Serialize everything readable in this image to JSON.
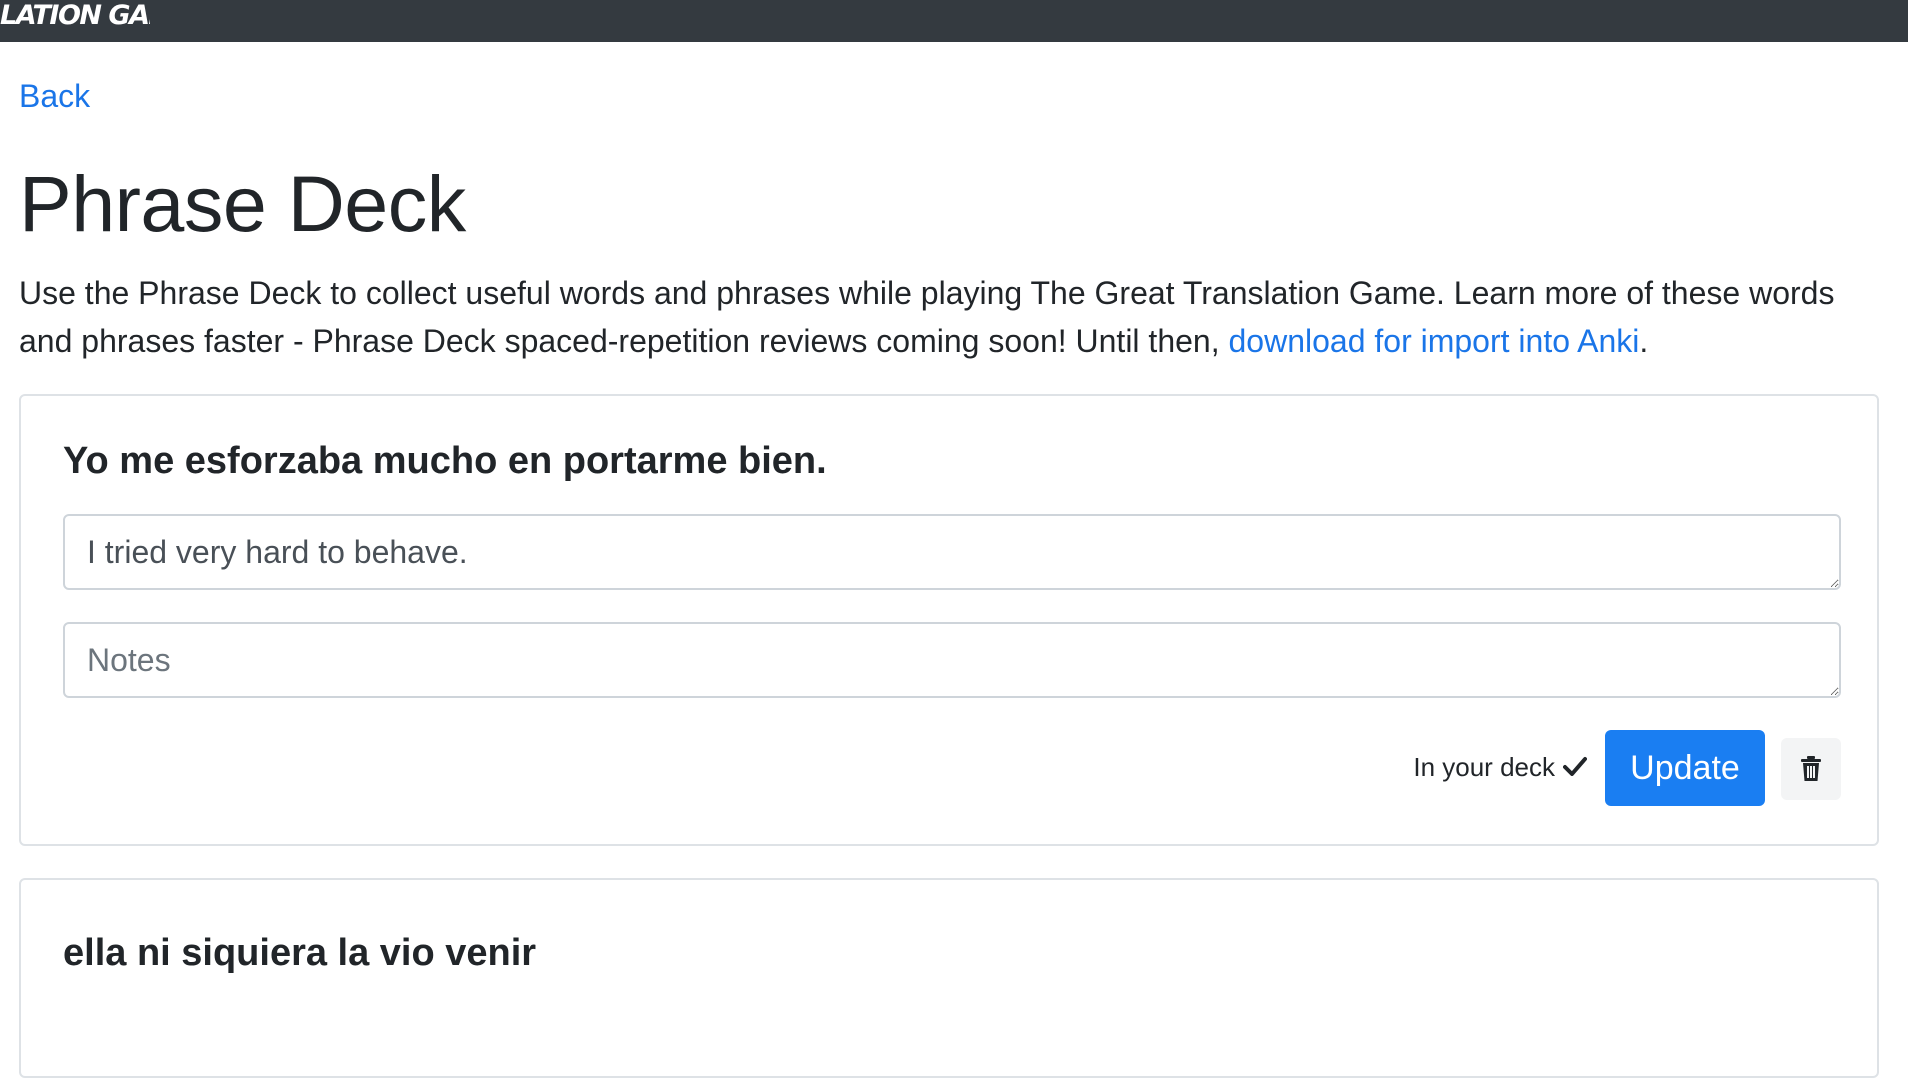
{
  "header": {
    "brand": "LATION GAME",
    "brand_full": "THE GREAT TRANSLATION GAME"
  },
  "nav": {
    "back_label": "Back"
  },
  "page": {
    "title": "Phrase Deck",
    "intro_text": "Use the Phrase Deck to collect useful words and phrases while playing The Great Translation Game. Learn more of these words and phrases faster - Phrase Deck spaced-repetition reviews coming soon! Until then, ",
    "intro_link": "download for import into Anki",
    "intro_end": "."
  },
  "cards": [
    {
      "phrase": "Yo me esforzaba mucho en portarme bien.",
      "translation": "I tried very hard to behave.",
      "notes_placeholder": "Notes",
      "notes_value": "",
      "status": "In your deck",
      "update_label": "Update",
      "delete_icon": "trash-icon"
    },
    {
      "phrase": "ella ni siquiera la vio venir"
    }
  ],
  "colors": {
    "topbar": "#343a40",
    "link": "#1a75e8",
    "primary": "#1a7ef2",
    "border": "#dee2e6"
  }
}
